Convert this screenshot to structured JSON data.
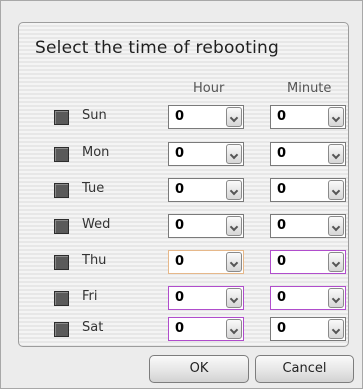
{
  "dialog": {
    "title": "Select  the time of rebooting",
    "hour_header": "Hour",
    "minute_header": "Minute"
  },
  "days": [
    {
      "label": "Sun",
      "hour": "0",
      "minute": "0"
    },
    {
      "label": "Mon",
      "hour": "0",
      "minute": "0"
    },
    {
      "label": "Tue",
      "hour": "0",
      "minute": "0"
    },
    {
      "label": "Wed",
      "hour": "0",
      "minute": "0"
    },
    {
      "label": "Thu",
      "hour": "0",
      "minute": "0"
    },
    {
      "label": "Fri",
      "hour": "0",
      "minute": "0"
    },
    {
      "label": "Sat",
      "hour": "0",
      "minute": "0"
    }
  ],
  "buttons": {
    "ok": "OK",
    "cancel": "Cancel"
  },
  "icons": {
    "dropdown": "chevron-down-icon",
    "checkbox": "checkbox-icon"
  },
  "colors": {
    "focus_orange": "#e6b88a",
    "focus_purple": "#b04dcc",
    "checkbox": "#5a5a5a"
  }
}
